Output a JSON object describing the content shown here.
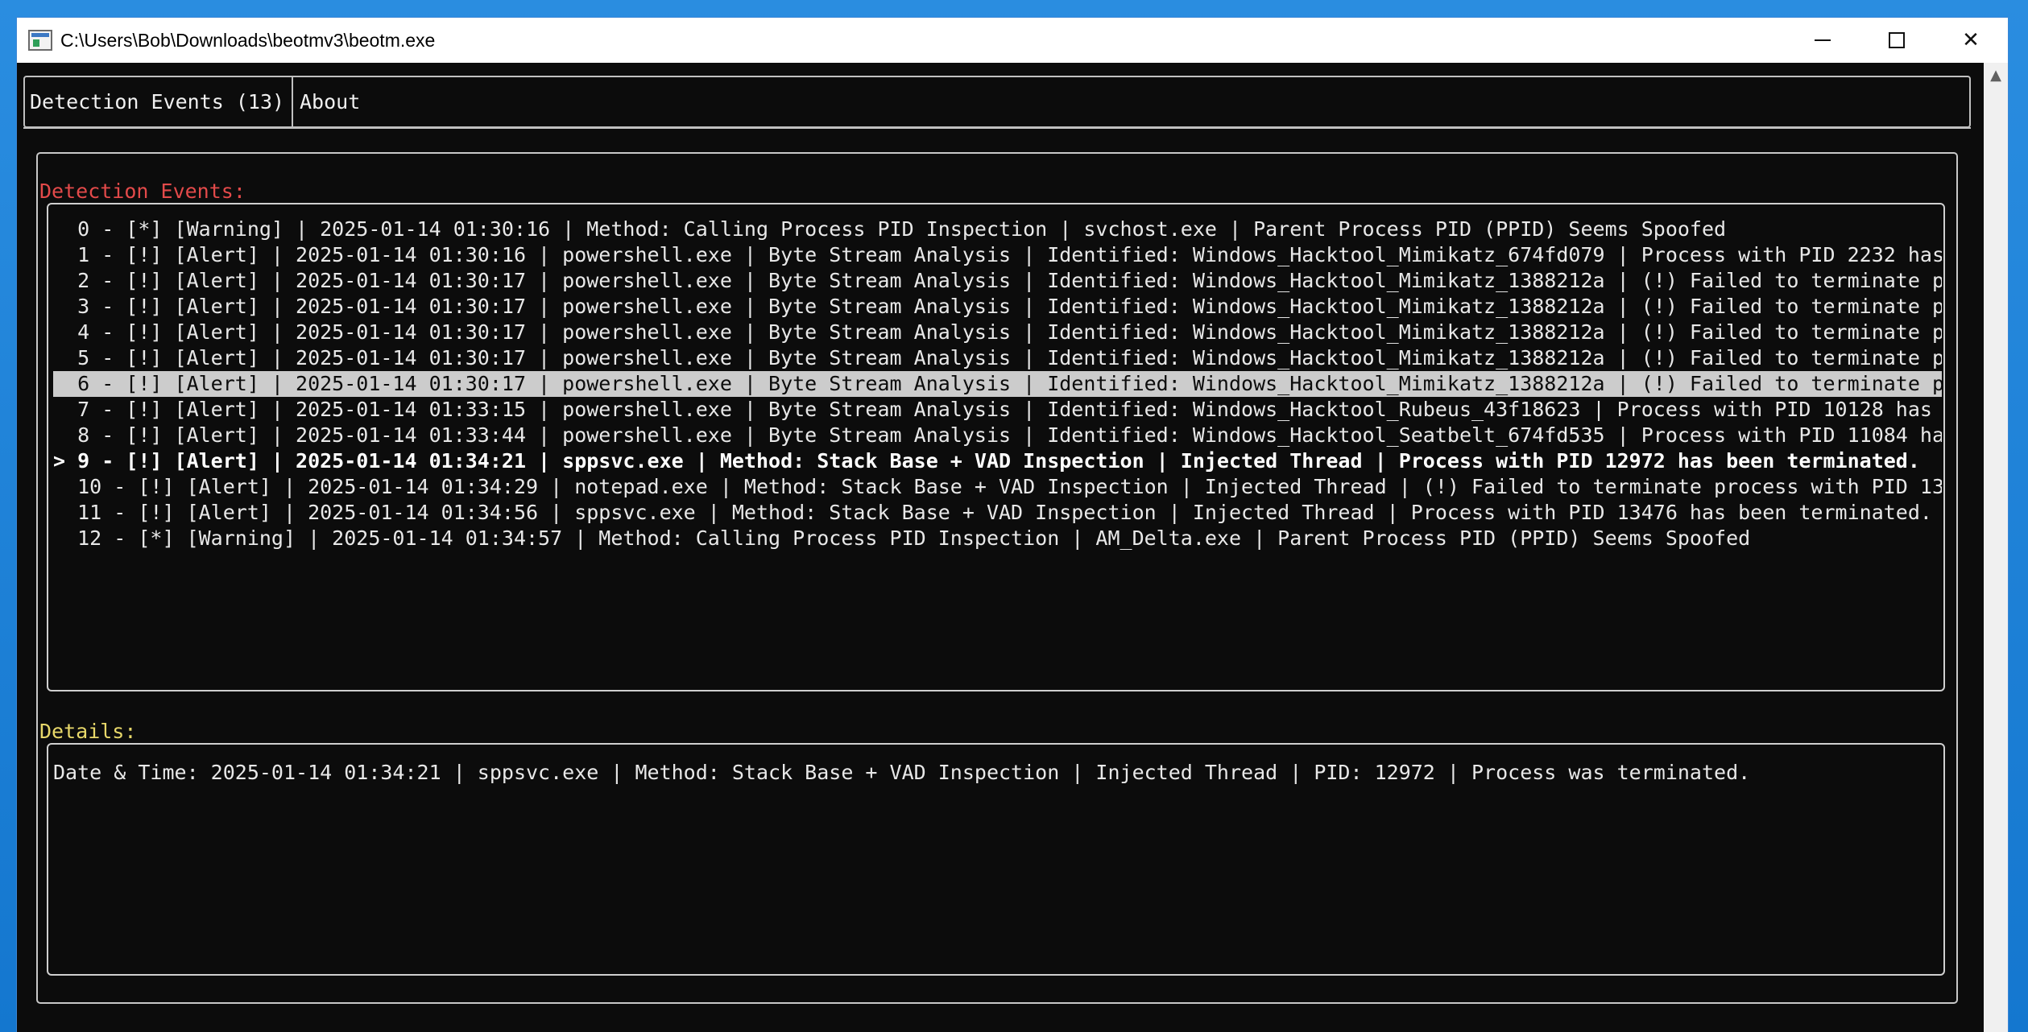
{
  "window": {
    "title": "C:\\Users\\Bob\\Downloads\\beotmv3\\beotm.exe",
    "controls": {
      "minimize": "—",
      "maximize": "☐",
      "close": "✕"
    }
  },
  "tabs": [
    {
      "label": "Detection Events (13)",
      "active": true
    },
    {
      "label": "About",
      "active": false
    }
  ],
  "events_section": {
    "label": "Detection Events:",
    "label_color": "#e34a4a",
    "rows": [
      "  0 - [*] [Warning] | 2025-01-14 01:30:16 | Method: Calling Process PID Inspection | svchost.exe | Parent Process PID (PPID) Seems Spoofed",
      "  1 - [!] [Alert] | 2025-01-14 01:30:16 | powershell.exe | Byte Stream Analysis | Identified: Windows_Hacktool_Mimikatz_674fd079 | Process with PID 2232 has",
      "  2 - [!] [Alert] | 2025-01-14 01:30:17 | powershell.exe | Byte Stream Analysis | Identified: Windows_Hacktool_Mimikatz_1388212a | (!) Failed to terminate p",
      "  3 - [!] [Alert] | 2025-01-14 01:30:17 | powershell.exe | Byte Stream Analysis | Identified: Windows_Hacktool_Mimikatz_1388212a | (!) Failed to terminate p",
      "  4 - [!] [Alert] | 2025-01-14 01:30:17 | powershell.exe | Byte Stream Analysis | Identified: Windows_Hacktool_Mimikatz_1388212a | (!) Failed to terminate p",
      "  5 - [!] [Alert] | 2025-01-14 01:30:17 | powershell.exe | Byte Stream Analysis | Identified: Windows_Hacktool_Mimikatz_1388212a | (!) Failed to terminate p",
      "  6 - [!] [Alert] | 2025-01-14 01:30:17 | powershell.exe | Byte Stream Analysis | Identified: Windows_Hacktool_Mimikatz_1388212a | (!) Failed to terminate p",
      "  7 - [!] [Alert] | 2025-01-14 01:33:15 | powershell.exe | Byte Stream Analysis | Identified: Windows_Hacktool_Rubeus_43f18623 | Process with PID 10128 has",
      "  8 - [!] [Alert] | 2025-01-14 01:33:44 | powershell.exe | Byte Stream Analysis | Identified: Windows_Hacktool_Seatbelt_674fd535 | Process with PID 11084 ha",
      "> 9 - [!] [Alert] | 2025-01-14 01:34:21 | sppsvc.exe | Method: Stack Base + VAD Inspection | Injected Thread | Process with PID 12972 has been terminated.",
      "  10 - [!] [Alert] | 2025-01-14 01:34:29 | notepad.exe | Method: Stack Base + VAD Inspection | Injected Thread | (!) Failed to terminate process with PID 13",
      "  11 - [!] [Alert] | 2025-01-14 01:34:56 | sppsvc.exe | Method: Stack Base + VAD Inspection | Injected Thread | Process with PID 13476 has been terminated.",
      "  12 - [*] [Warning] | 2025-01-14 01:34:57 | Method: Calling Process PID Inspection | AM_Delta.exe | Parent Process PID (PPID) Seems Spoofed"
    ],
    "highlighted_index": 6,
    "selected_index": 9
  },
  "details_section": {
    "label": "Details:",
    "label_color": "#e8d86a",
    "text": "Date & Time: 2025-01-14 01:34:21 | sppsvc.exe | Method: Stack Base + VAD Inspection | Injected Thread | PID: 12972 | Process was terminated."
  },
  "colors": {
    "background": "#0c0c0c",
    "highlight_row": "#cccccc",
    "desktop": "#1b7fd4"
  }
}
